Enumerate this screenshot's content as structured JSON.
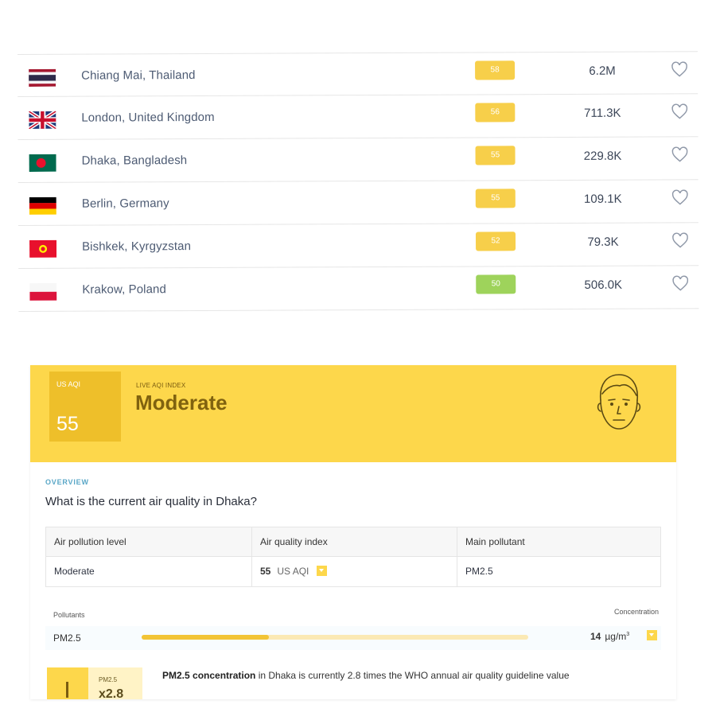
{
  "colors": {
    "moderate": "#fdd74b",
    "moderate_badge": "#f7cf4a",
    "good_badge": "#9ed35b",
    "moderate_box": "#eebf2a",
    "text_city": "#4d5b73"
  },
  "cities": [
    {
      "name": "Chiang Mai, Thailand",
      "aqi": "58",
      "followers": "6.2M",
      "flag_icon": "thailand-flag-icon",
      "badge_color": "#f7cf4a"
    },
    {
      "name": "London, United Kingdom",
      "aqi": "56",
      "followers": "711.3K",
      "flag_icon": "uk-flag-icon",
      "badge_color": "#f7cf4a"
    },
    {
      "name": "Dhaka, Bangladesh",
      "aqi": "55",
      "followers": "229.8K",
      "flag_icon": "bangladesh-flag-icon",
      "badge_color": "#f7cf4a"
    },
    {
      "name": "Berlin, Germany",
      "aqi": "55",
      "followers": "109.1K",
      "flag_icon": "germany-flag-icon",
      "badge_color": "#f7cf4a"
    },
    {
      "name": "Bishkek, Kyrgyzstan",
      "aqi": "52",
      "followers": "79.3K",
      "flag_icon": "kyrgyzstan-flag-icon",
      "badge_color": "#f7cf4a"
    },
    {
      "name": "Krakow, Poland",
      "aqi": "50",
      "followers": "506.0K",
      "flag_icon": "poland-flag-icon",
      "badge_color": "#9ed35b"
    }
  ],
  "card": {
    "aqi_label": "US AQI",
    "aqi_value": "55",
    "live_label": "LIVE AQI INDEX",
    "status": "Moderate",
    "face_icon": "face-icon",
    "overview_label": "OVERVIEW",
    "question": "What is the current air quality in Dhaka?",
    "table": {
      "headers": [
        "Air pollution level",
        "Air quality index",
        "Main pollutant"
      ],
      "level": "Moderate",
      "aqi_number": "55",
      "aqi_unit": "US AQI",
      "main_pollutant": "PM2.5"
    },
    "pollutants_label": "Pollutants",
    "concentration_label": "Concentration",
    "pollutant": {
      "name": "PM2.5",
      "value": "14",
      "unit": "µg/m",
      "unit_exp": "3",
      "level_fraction": 0.33
    },
    "who": {
      "label": "PM2.5",
      "multiplier": "x2.8",
      "text_bold": "PM2.5 concentration",
      "text_rest": " in Dhaka is currently 2.8 times the WHO annual air quality guideline value"
    }
  }
}
